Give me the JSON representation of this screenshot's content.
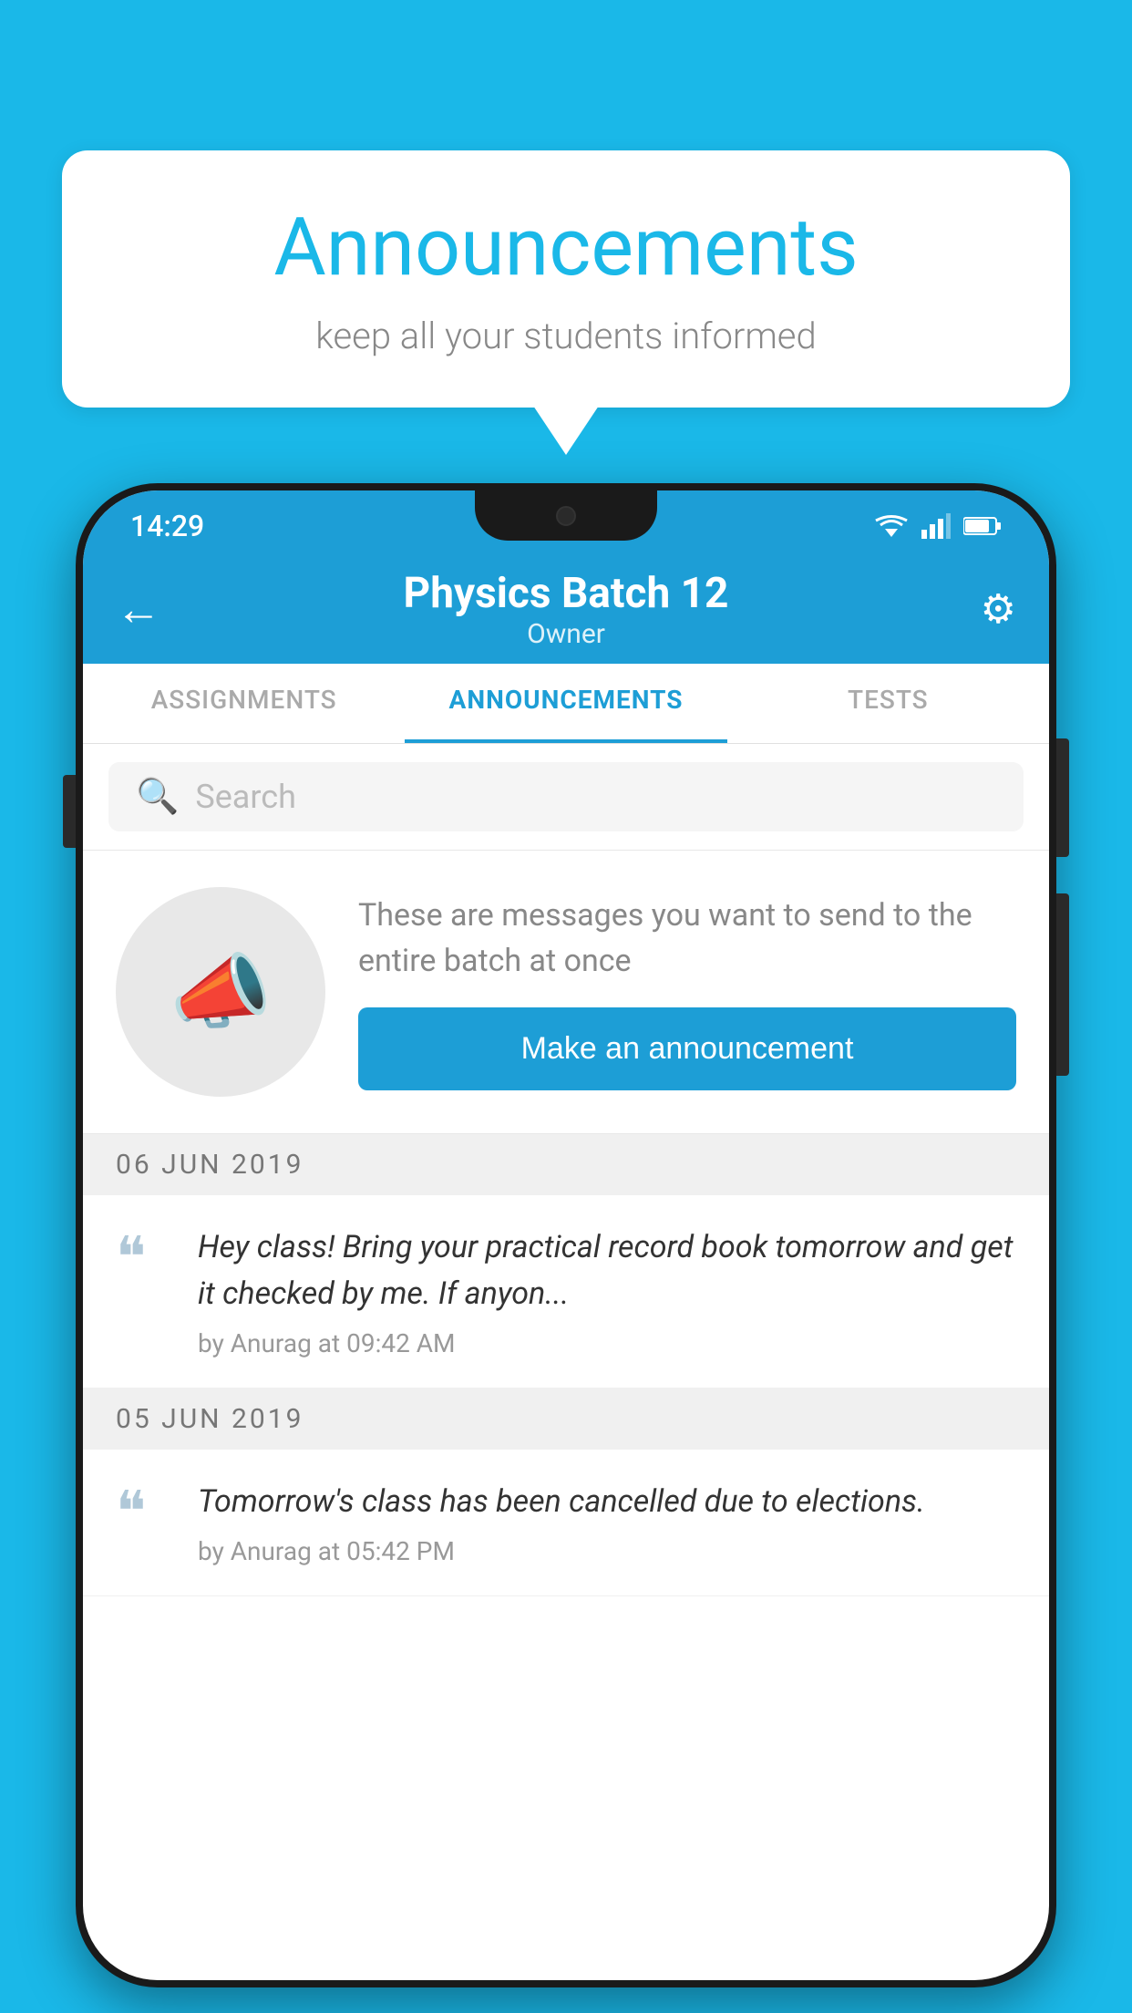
{
  "background_color": "#1ab8e8",
  "speech_bubble": {
    "title": "Announcements",
    "subtitle": "keep all your students informed"
  },
  "phone": {
    "status_bar": {
      "time": "14:29"
    },
    "app_bar": {
      "title": "Physics Batch 12",
      "subtitle": "Owner",
      "back_label": "←",
      "settings_label": "⚙"
    },
    "tabs": [
      {
        "label": "ASSIGNMENTS",
        "active": false
      },
      {
        "label": "ANNOUNCEMENTS",
        "active": true
      },
      {
        "label": "TESTS",
        "active": false
      }
    ],
    "search": {
      "placeholder": "Search"
    },
    "promo": {
      "description_text": "These are messages you want to send to the entire batch at once",
      "button_label": "Make an announcement"
    },
    "announcements": [
      {
        "date": "06  JUN  2019",
        "message": "Hey class! Bring your practical record book tomorrow and get it checked by me. If anyon...",
        "meta": "by Anurag at 09:42 AM"
      },
      {
        "date": "05  JUN  2019",
        "message": "Tomorrow's class has been cancelled due to elections.",
        "meta": "by Anurag at 05:42 PM"
      }
    ]
  }
}
